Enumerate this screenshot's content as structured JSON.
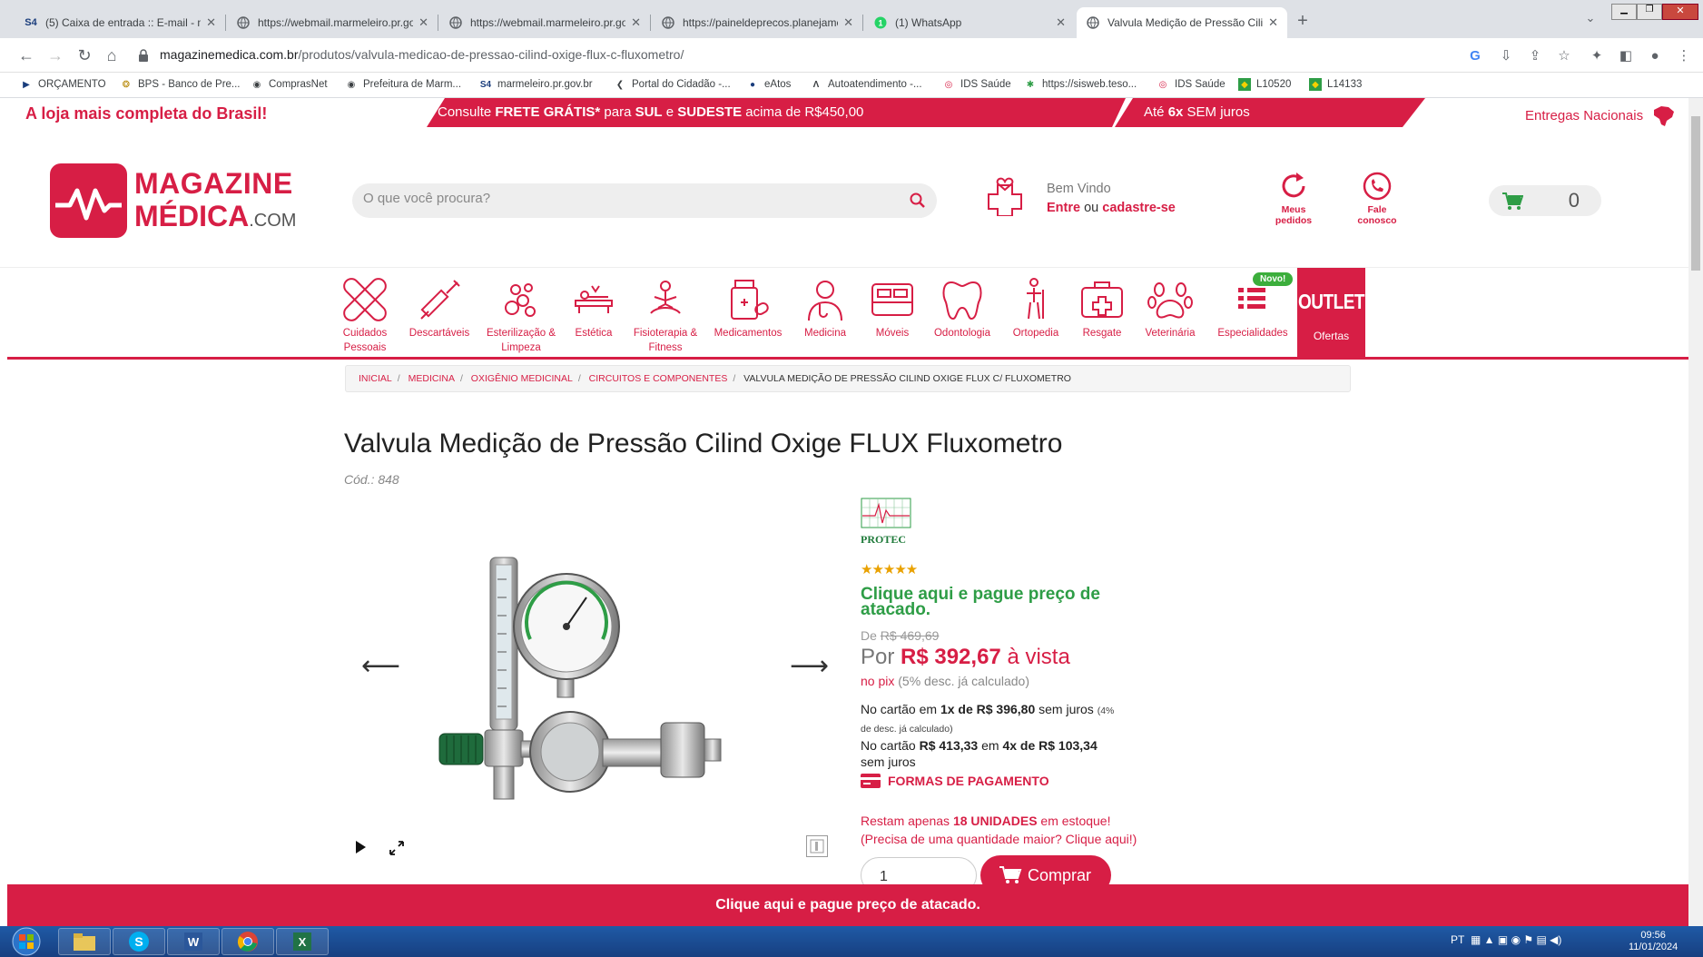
{
  "browser": {
    "tabs": [
      {
        "title": "(5) Caixa de entrada :: E-mail - m",
        "favicon": "S4"
      },
      {
        "title": "https://webmail.marmeleiro.pr.go",
        "favicon": "globe-icon"
      },
      {
        "title": "https://webmail.marmeleiro.pr.go",
        "favicon": "globe-icon"
      },
      {
        "title": "https://paineldeprecos.planejame",
        "favicon": "globe-icon"
      },
      {
        "title": "(1) WhatsApp",
        "favicon": "whatsapp-icon"
      },
      {
        "title": "Valvula Medição de Pressão Cilin",
        "favicon": "globe-icon"
      }
    ],
    "url_host": "magazinemedica.com.br",
    "url_path": "/produtos/valvula-medicao-de-pressao-cilind-oxige-flux-c-fluxometro/",
    "bookmarks": [
      "ORÇAMENTO",
      "BPS - Banco de Pre...",
      "ComprasNet",
      "Prefeitura de Marm...",
      "marmeleiro.pr.gov.br",
      "Portal do Cidadão -...",
      "eAtos",
      "Autoatendimento -...",
      "IDS Saúde",
      "https://sisweb.teso...",
      "IDS Saúde",
      "L10520",
      "L14133"
    ]
  },
  "promo": {
    "left": "A loja mais completa do Brasil!",
    "shipping_pre": "Consulte ",
    "shipping_b1": "FRETE GRÁTIS*",
    "shipping_mid": " para ",
    "shipping_b2": "SUL",
    "shipping_mid2": " e ",
    "shipping_b3": "SUDESTE",
    "shipping_post": " acima de R$450,00",
    "install_pre": "Até ",
    "install_b": "6x",
    "install_post": " SEM juros",
    "right": "Entregas Nacionais"
  },
  "header": {
    "logo_line1": "MAGAZINE",
    "logo_line2": "MÉDICA",
    "logo_com": ".COM",
    "search_placeholder": "O que você procura?",
    "welcome": "Bem Vindo",
    "login_enter": "Entre",
    "login_or": " ou ",
    "login_register": "cadastre-se",
    "orders": "Meus pedidos",
    "contact": "Fale conosco",
    "cart_count": "0"
  },
  "categories": [
    "Cuidados Pessoais",
    "Descartáveis",
    "Esterilização & Limpeza",
    "Estética",
    "Fisioterapia & Fitness",
    "Medicamentos",
    "Medicina",
    "Móveis",
    "Odontologia",
    "Ortopedia",
    "Resgate",
    "Veterinária",
    "Especialidades"
  ],
  "novo_badge": "Novo!",
  "outlet": {
    "title": "OUTLET",
    "label": "Ofertas"
  },
  "breadcrumb": [
    "INICIAL",
    "MEDICINA",
    "OXIGÊNIO MEDICINAL",
    "CIRCUITOS E COMPONENTES"
  ],
  "breadcrumb_current": "VALVULA MEDIÇÃO DE PRESSÃO CILIND OXIGE FLUX C/ FLUXOMETRO",
  "product": {
    "title": "Valvula Medição de Pressão Cilind Oxige FLUX Fluxometro",
    "code": "Cód.: 848",
    "brand": "PROTEC",
    "rating": 5,
    "stars": "★★★★★",
    "wholesale_link": "Clique aqui e pague preço de atacado.",
    "old_price_label": "De ",
    "old_price": "R$ 469,69",
    "price_label": "Por ",
    "price": "R$ 392,67",
    "price_suffix": " à vista",
    "pix": "no pix",
    "pix_note": " (5% desc. já calculado)",
    "card1_pre": "No cartão em ",
    "card1_b": "1x de R$ 396,80",
    "card1_post": " sem juros ",
    "card1_note1": "(4%",
    "card1_note2": "de desc. já calculado)",
    "card2_pre": "No cartão ",
    "card2_b1": "R$ 413,33",
    "card2_mid": " em ",
    "card2_b2": "4x de R$ 103,34",
    "card2_post": "sem juros",
    "payment_forms": "FORMAS DE PAGAMENTO",
    "stock_pre": "Restam apenas ",
    "stock_b": "18 UNIDADES",
    "stock_post": " em estoque!",
    "stock_more": "(Precisa de uma quantidade maior? Clique aqui!)",
    "quantity": "1",
    "buy": "Comprar"
  },
  "sticky_bar": "Clique aqui e pague preço de atacado.",
  "taskbar": {
    "lang": "PT",
    "time": "09:56",
    "date": "11/01/2024"
  },
  "colors": {
    "brand": "#d71e45",
    "green": "#2e9d46",
    "taskbar": "#1f5aa6"
  }
}
